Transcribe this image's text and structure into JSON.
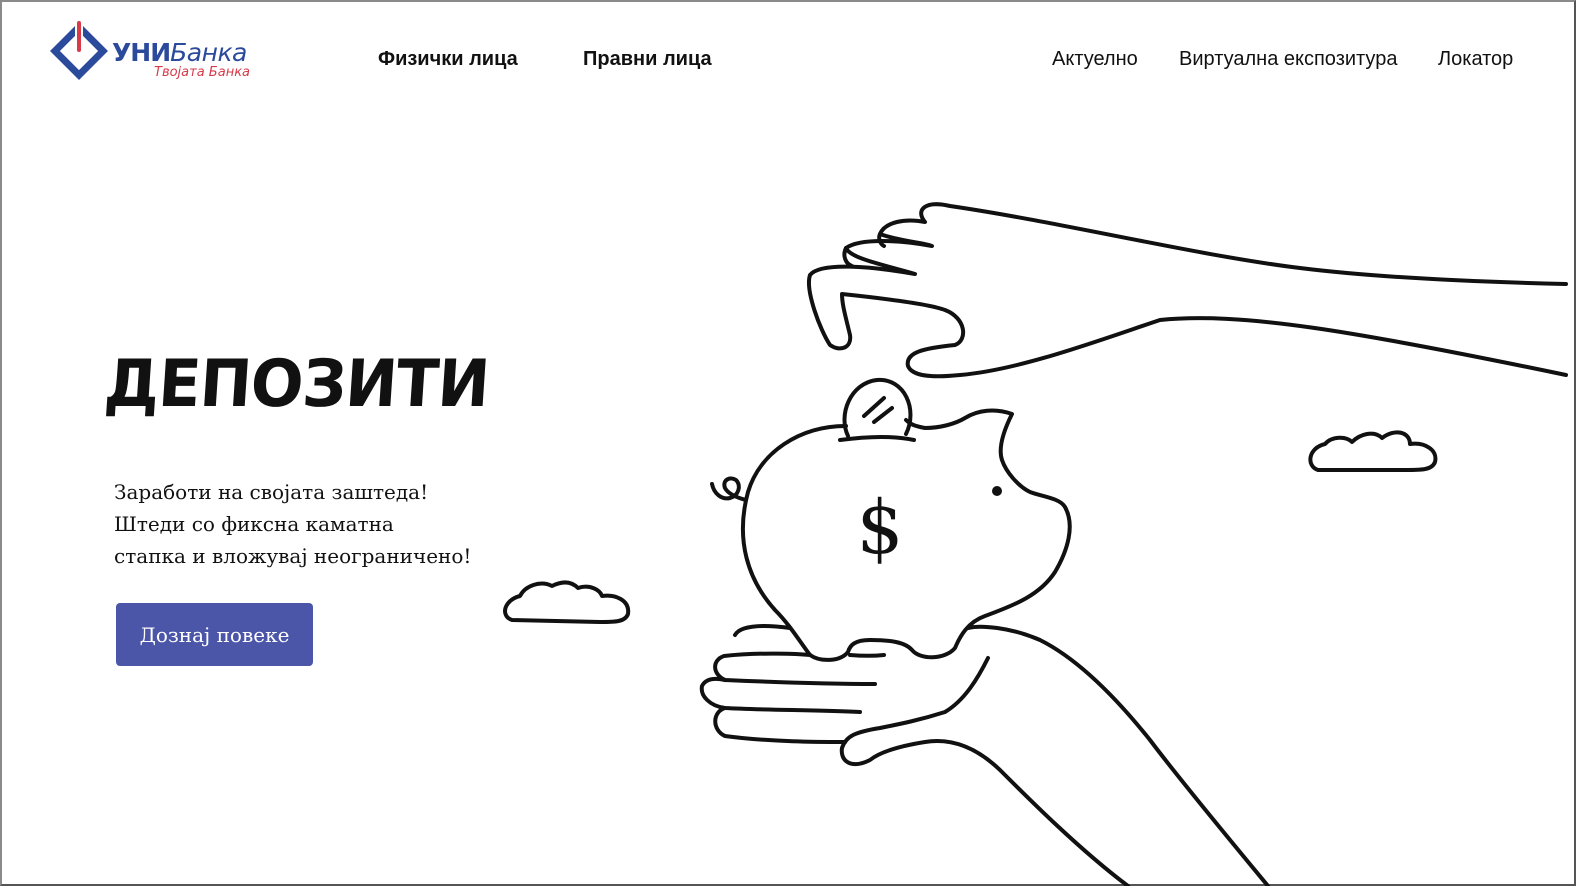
{
  "brand": {
    "name_bold": "УНИ",
    "name_italic": "Банка",
    "tagline": "Твојата Банка",
    "primary_color": "#2b4a9c",
    "accent_color": "#d83a4a",
    "icon": "power-icon"
  },
  "nav": {
    "left": [
      {
        "label": "Физички лица"
      },
      {
        "label": "Правни лица"
      }
    ],
    "right": [
      {
        "label": "Актуелно"
      },
      {
        "label": "Виртуална експозитура"
      },
      {
        "label": "Локатор"
      }
    ]
  },
  "hero": {
    "title": "ДЕПОЗИТИ",
    "description": [
      "Заработи на својата заштеда!",
      "Штеди со фиксна каматна",
      "стапка и вложувај неограничено!"
    ],
    "cta_label": "Дознај повеке",
    "cta_color": "#4c56a8"
  },
  "illustration": {
    "coin_symbol": "$",
    "icons": [
      "hand-icon",
      "piggy-bank-icon",
      "coin-icon",
      "cloud-icon"
    ]
  }
}
